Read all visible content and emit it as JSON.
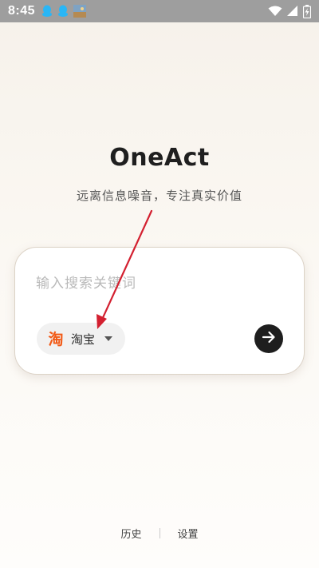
{
  "status_bar": {
    "time": "8:45",
    "left_icons": [
      "qq-icon",
      "qq-icon",
      "photo-thumbnail-icon"
    ],
    "right_icons": [
      "wifi-icon",
      "signal-icon",
      "battery-charging-icon"
    ]
  },
  "header": {
    "title": "OneAct",
    "subtitle": "远离信息噪音，专注真实价值"
  },
  "search": {
    "placeholder": "输入搜索关键词",
    "value": "",
    "engine": {
      "label": "淘宝",
      "icon": "taobao-icon",
      "icon_color": "#f25a16"
    },
    "go_icon": "arrow-right-icon"
  },
  "footer": {
    "history_label": "历史",
    "settings_label": "设置"
  },
  "colors": {
    "annotation_arrow": "#d32030",
    "go_button": "#1e1e1e"
  }
}
